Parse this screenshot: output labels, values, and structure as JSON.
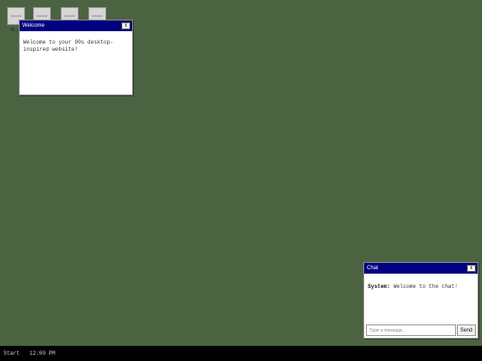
{
  "desktop": {
    "icons": [
      {
        "icon": "document-icon",
        "caption": "M..."
      },
      {
        "icon": "document-icon",
        "caption": ""
      },
      {
        "icon": "document-icon",
        "caption": ""
      },
      {
        "icon": "document-icon",
        "caption": ""
      }
    ]
  },
  "welcome_window": {
    "title": "Welcome",
    "close_label": "x",
    "body": "Welcome to your 90s desktop-inspired website!"
  },
  "chat_window": {
    "title": "Chat",
    "close_label": "x",
    "messages": [
      {
        "sender": "System:",
        "text": "Welcome to the chat!"
      }
    ],
    "input_placeholder": "Type a message...",
    "input_value": "",
    "send_label": "Send"
  },
  "taskbar": {
    "start_label": "Start",
    "clock": "12:00 PM"
  },
  "colors": {
    "desktop_background": "#4b6341",
    "titlebar": "#000080",
    "taskbar": "#000000"
  }
}
